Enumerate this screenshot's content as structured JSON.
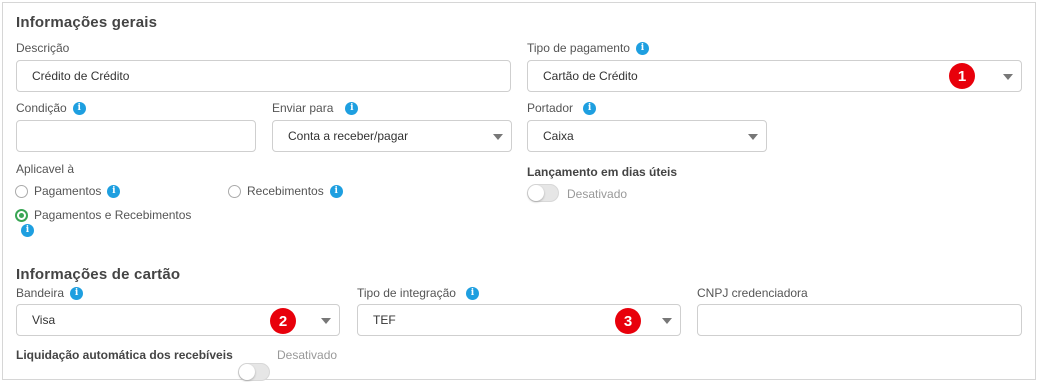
{
  "general": {
    "title": "Informações gerais",
    "descricao": {
      "label": "Descrição",
      "value": "Crédito de Crédito"
    },
    "tipo_pagamento": {
      "label": "Tipo de pagamento",
      "value": "Cartão de Crédito",
      "badge": "1"
    },
    "condicao": {
      "label": "Condição",
      "value": ""
    },
    "enviar_para": {
      "label": "Enviar para",
      "value": "Conta a receber/pagar"
    },
    "portador": {
      "label": "Portador",
      "value": "Caixa"
    },
    "aplicavel": {
      "label": "Aplicavel à",
      "options": [
        {
          "label": "Pagamentos",
          "checked": false
        },
        {
          "label": "Recebimentos",
          "checked": false
        },
        {
          "label": "Pagamentos e Recebimentos",
          "checked": true
        }
      ]
    },
    "lancamento": {
      "label": "Lançamento em dias úteis",
      "state": "Desativado"
    }
  },
  "card": {
    "title": "Informações de cartão",
    "bandeira": {
      "label": "Bandeira",
      "value": "Visa",
      "badge": "2"
    },
    "tipo_integracao": {
      "label": "Tipo de integração",
      "value": "TEF",
      "badge": "3"
    },
    "cnpj": {
      "label": "CNPJ credenciadora",
      "value": ""
    },
    "liquidacao": {
      "label": "Liquidação automática dos recebíveis",
      "state": "Desativado"
    }
  },
  "icons": {
    "info": "info-icon",
    "info_glyph": "i",
    "caret": "chevron-down-icon"
  },
  "colors": {
    "info": "#1e9fe0",
    "badge": "#e8000b",
    "radio_checked": "#3aa655"
  }
}
